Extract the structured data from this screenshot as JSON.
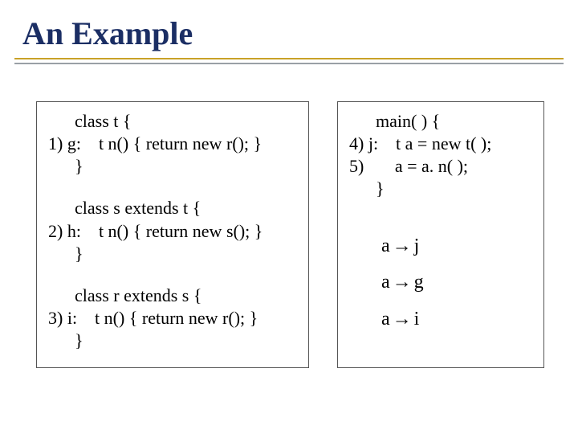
{
  "title": "An Example",
  "left": {
    "b1l1": "      class t {",
    "b1l2": "1) g:    t n() { return new r(); }",
    "b1l3": "      }",
    "b2l1": "      class s extends t {",
    "b2l2": "2) h:    t n() { return new s(); }",
    "b2l3": "      }",
    "b3l1": "      class r extends s {",
    "b3l2": "3) i:    t n() { return new r(); }",
    "b3l3": "      }"
  },
  "right": {
    "m1": "      main( ) {",
    "m2": "4) j:    t a = new t( );",
    "m3": "5)       a = a. n( );",
    "m4": "      }",
    "arrows": {
      "a1_lhs": "a",
      "a1_sym": "→",
      "a1_rhs": "j",
      "a2_lhs": "a",
      "a2_sym": "→",
      "a2_rhs": "g",
      "a3_lhs": "a",
      "a3_sym": "→",
      "a3_rhs": "i"
    }
  }
}
